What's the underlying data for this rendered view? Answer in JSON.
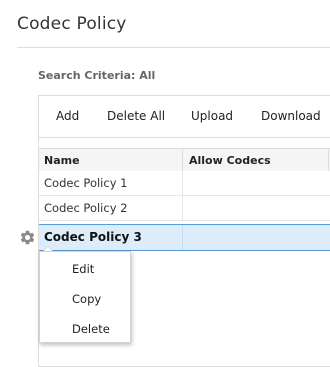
{
  "page": {
    "title": "Codec Policy"
  },
  "search": {
    "criteria_label": "Search Criteria: All"
  },
  "toolbar": {
    "add_label": "Add",
    "delete_all_label": "Delete All",
    "upload_label": "Upload",
    "download_label": "Download"
  },
  "table": {
    "columns": [
      "Name",
      "Allow Codecs"
    ],
    "rows": [
      {
        "name": "Codec Policy 1",
        "allow_codecs": ""
      },
      {
        "name": "Codec Policy 2",
        "allow_codecs": ""
      },
      {
        "name": "Codec Policy 3",
        "allow_codecs": "",
        "selected": true
      }
    ]
  },
  "row_actions": {
    "icon": "gear-icon",
    "menu": [
      "Edit",
      "Copy",
      "Delete"
    ]
  },
  "colors": {
    "selected_row_bg": "#dcecfb",
    "selected_row_border": "#5b9bd5"
  }
}
